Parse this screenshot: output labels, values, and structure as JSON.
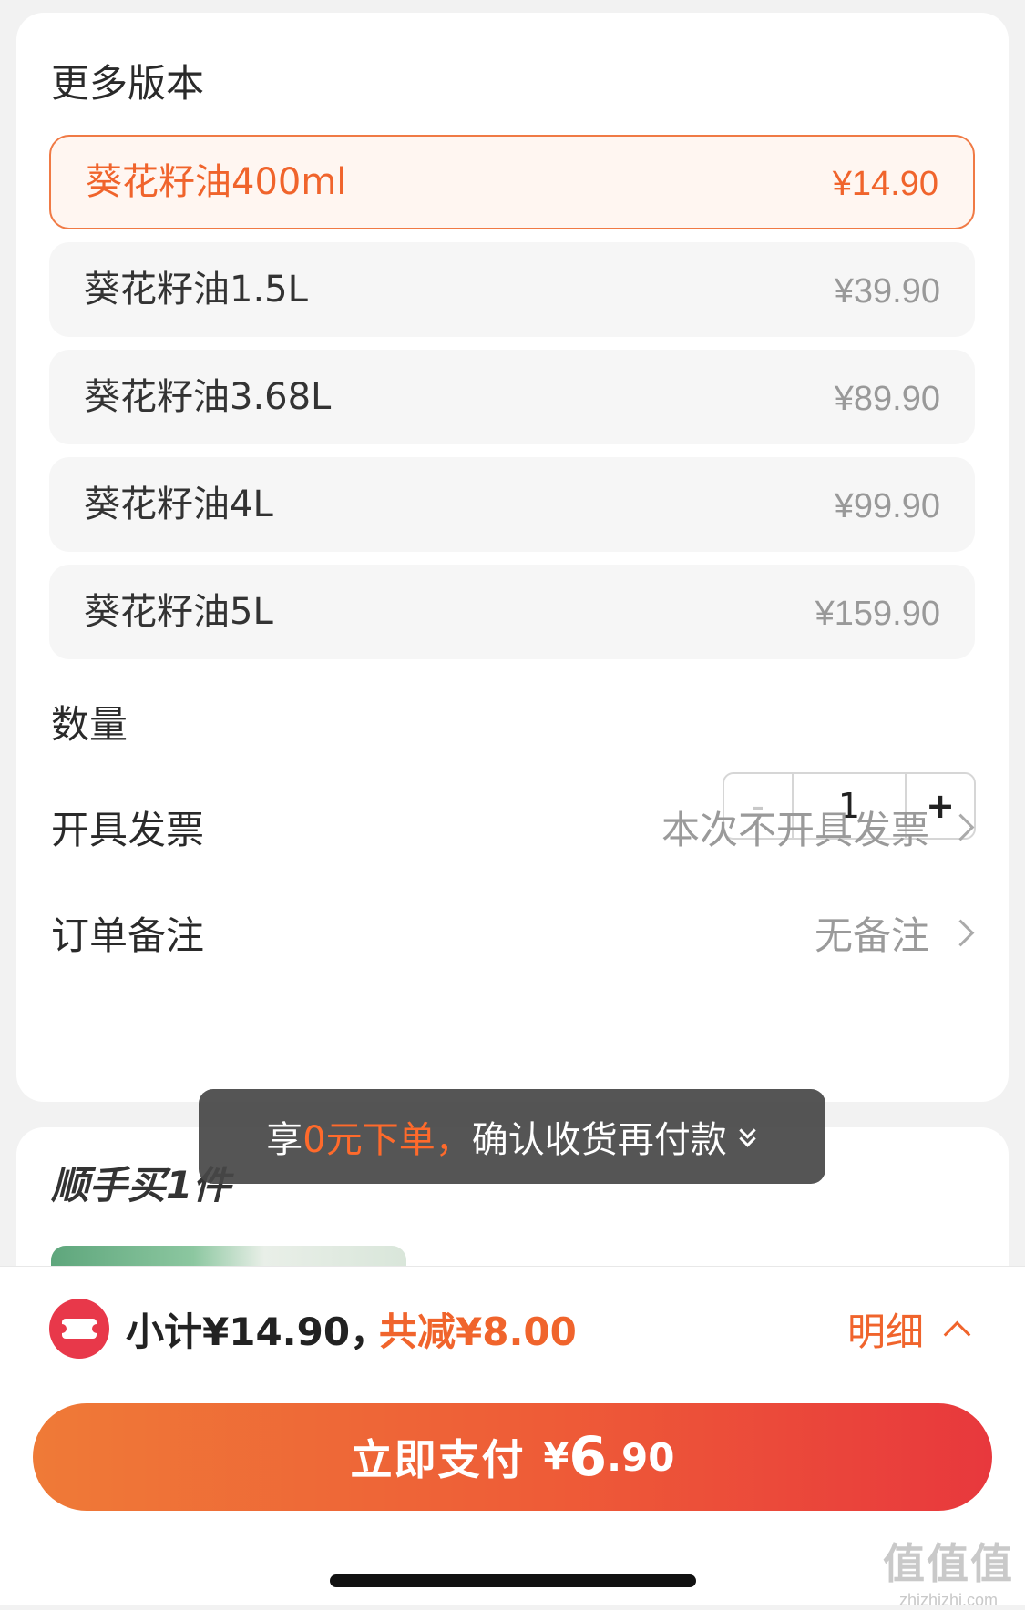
{
  "more_versions": {
    "title": "更多版本",
    "variants": [
      {
        "name": "葵花籽油400ml",
        "price": "¥14.90",
        "selected": true
      },
      {
        "name": "葵花籽油1.5L",
        "price": "¥39.90",
        "selected": false
      },
      {
        "name": "葵花籽油3.68L",
        "price": "¥89.90",
        "selected": false
      },
      {
        "name": "葵花籽油4L",
        "price": "¥99.90",
        "selected": false
      },
      {
        "name": "葵花籽油5L",
        "price": "¥159.90",
        "selected": false
      }
    ]
  },
  "quantity": {
    "label": "数量",
    "value": "1",
    "minus": "-",
    "plus": "+"
  },
  "invoice": {
    "label": "开具发票",
    "value": "本次不开具发票"
  },
  "remark": {
    "label": "订单备注",
    "value": "无备注"
  },
  "tooltip": {
    "prefix": "享",
    "highlight": "0元下单，",
    "suffix": "确认收货再付款"
  },
  "addon": {
    "title": "顺手买1件"
  },
  "summary": {
    "subtotal": "小计¥14.90，",
    "discount": "共减¥8.00",
    "detail": "明细"
  },
  "pay_button": {
    "label": "立即支付",
    "currency": "¥",
    "integer": "6",
    "decimal": ".90"
  },
  "watermark": {
    "line1": "值值值",
    "line2": "zhizhizhi.com"
  },
  "colors": {
    "accent": "#f0642c",
    "pay_start": "#ef7a37",
    "pay_end": "#e8383d",
    "coupon": "#e8384a"
  }
}
